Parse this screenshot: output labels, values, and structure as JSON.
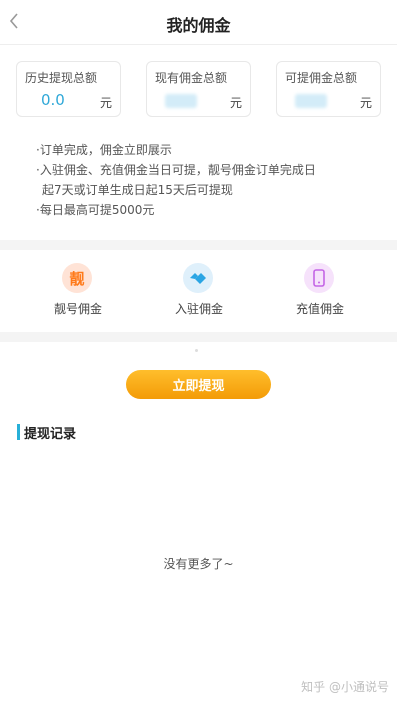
{
  "header": {
    "title": "我的佣金",
    "back_icon": "chevron-left-icon"
  },
  "stats": [
    {
      "label": "历史提现总额",
      "value": "0.0",
      "unit": "元"
    },
    {
      "label": "现有佣金总额",
      "value": "",
      "unit": "元"
    },
    {
      "label": "可提佣金总额",
      "value": "",
      "unit": "元"
    }
  ],
  "rules": [
    "·订单完成，佣金立即展示",
    "·入驻佣金、充值佣金当日可提，靓号佣金订单完成日",
    "起7天或订单生成日起15天后可提现",
    "·每日最高可提5000元"
  ],
  "commission_types": [
    {
      "label": "靓号佣金",
      "icon": "liang-character-icon",
      "icon_glyph": "靓",
      "color": "#ff7a1a",
      "bg": "#ffe3d6"
    },
    {
      "label": "入驻佣金",
      "icon": "handshake-icon",
      "color": "#2aa5e4",
      "bg": "#dff0fb"
    },
    {
      "label": "充值佣金",
      "icon": "phone-recharge-icon",
      "color": "#c465e6",
      "bg": "#f6e2fb"
    }
  ],
  "actions": {
    "withdraw_label": "立即提现"
  },
  "records": {
    "title": "提现记录",
    "empty_text": "没有更多了~"
  },
  "watermark": "知乎 @小通说号",
  "colors": {
    "accent": "#2fa8d8",
    "button_top": "#ffbe2c",
    "button_bottom": "#f39b07",
    "divider": "#f4f4f4"
  }
}
